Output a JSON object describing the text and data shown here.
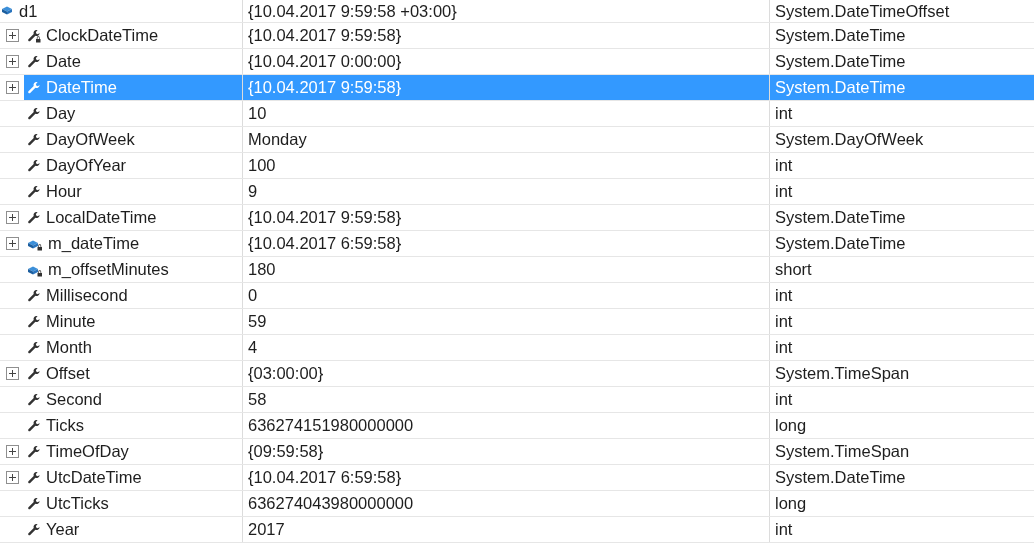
{
  "watch": {
    "name": "d1",
    "value": "{10.04.2017 9:59:58 +03:00}",
    "type": "System.DateTimeOffset",
    "kind": "local",
    "selected": false,
    "children": [
      {
        "name": "ClockDateTime",
        "value": "{10.04.2017 9:59:58}",
        "type": "System.DateTime",
        "kind": "private_property",
        "expandable": true,
        "selected": false
      },
      {
        "name": "Date",
        "value": "{10.04.2017 0:00:00}",
        "type": "System.DateTime",
        "kind": "property",
        "expandable": true,
        "selected": false
      },
      {
        "name": "DateTime",
        "value": "{10.04.2017 9:59:58}",
        "type": "System.DateTime",
        "kind": "property",
        "expandable": true,
        "selected": true
      },
      {
        "name": "Day",
        "value": "10",
        "type": "int",
        "kind": "property",
        "expandable": false,
        "selected": false
      },
      {
        "name": "DayOfWeek",
        "value": "Monday",
        "type": "System.DayOfWeek",
        "kind": "property",
        "expandable": false,
        "selected": false
      },
      {
        "name": "DayOfYear",
        "value": "100",
        "type": "int",
        "kind": "property",
        "expandable": false,
        "selected": false
      },
      {
        "name": "Hour",
        "value": "9",
        "type": "int",
        "kind": "property",
        "expandable": false,
        "selected": false
      },
      {
        "name": "LocalDateTime",
        "value": "{10.04.2017 9:59:58}",
        "type": "System.DateTime",
        "kind": "property",
        "expandable": true,
        "selected": false
      },
      {
        "name": "m_dateTime",
        "value": "{10.04.2017 6:59:58}",
        "type": "System.DateTime",
        "kind": "private_field",
        "expandable": true,
        "selected": false
      },
      {
        "name": "m_offsetMinutes",
        "value": "180",
        "type": "short",
        "kind": "private_field",
        "expandable": false,
        "selected": false
      },
      {
        "name": "Millisecond",
        "value": "0",
        "type": "int",
        "kind": "property",
        "expandable": false,
        "selected": false
      },
      {
        "name": "Minute",
        "value": "59",
        "type": "int",
        "kind": "property",
        "expandable": false,
        "selected": false
      },
      {
        "name": "Month",
        "value": "4",
        "type": "int",
        "kind": "property",
        "expandable": false,
        "selected": false
      },
      {
        "name": "Offset",
        "value": "{03:00:00}",
        "type": "System.TimeSpan",
        "kind": "property",
        "expandable": true,
        "selected": false
      },
      {
        "name": "Second",
        "value": "58",
        "type": "int",
        "kind": "property",
        "expandable": false,
        "selected": false
      },
      {
        "name": "Ticks",
        "value": "636274151980000000",
        "type": "long",
        "kind": "property",
        "expandable": false,
        "selected": false
      },
      {
        "name": "TimeOfDay",
        "value": "{09:59:58}",
        "type": "System.TimeSpan",
        "kind": "property",
        "expandable": true,
        "selected": false
      },
      {
        "name": "UtcDateTime",
        "value": "{10.04.2017 6:59:58}",
        "type": "System.DateTime",
        "kind": "property",
        "expandable": true,
        "selected": false
      },
      {
        "name": "UtcTicks",
        "value": "636274043980000000",
        "type": "long",
        "kind": "property",
        "expandable": false,
        "selected": false
      },
      {
        "name": "Year",
        "value": "2017",
        "type": "int",
        "kind": "property",
        "expandable": false,
        "selected": false
      }
    ]
  }
}
